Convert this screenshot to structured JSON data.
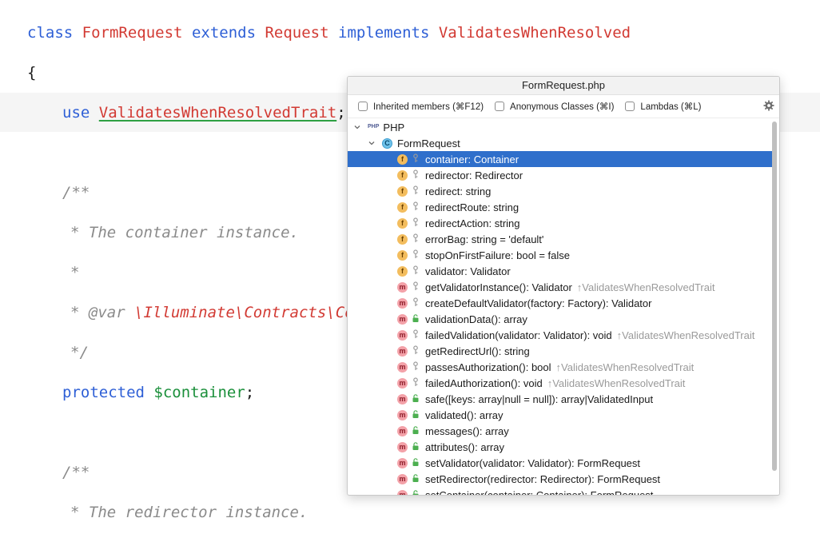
{
  "editor": {
    "line1": {
      "kw_class": "class",
      "name": "FormRequest",
      "kw_extends": "extends",
      "parent": "Request",
      "kw_implements": "implements",
      "iface": "ValidatesWhenResolved"
    },
    "brace": "{",
    "use_line": {
      "kw": "use",
      "trait": "ValidatesWhenResolvedTrait",
      "semi": ";"
    },
    "doc1_open": "/**",
    "doc1_text": "* The container instance.",
    "doc1_star": "*",
    "doc1_var_tag": "* @var",
    "doc1_var_type": "\\Illuminate\\Contracts\\Con",
    "doc1_close": "*/",
    "prop": {
      "kw": "protected",
      "var": "$container",
      "semi": ";"
    },
    "doc2_open": "/**",
    "doc2_text": "* The redirector instance."
  },
  "popup": {
    "title": "FormRequest.php",
    "filters": [
      {
        "label": "Inherited members (⌘F12)",
        "checked": false
      },
      {
        "label": "Anonymous Classes (⌘I)",
        "checked": false
      },
      {
        "label": "Lambdas (⌘L)",
        "checked": false
      }
    ],
    "settings_icon": "gear-icon",
    "root": {
      "label": "PHP",
      "icon": "php-icon"
    },
    "class_node": {
      "label": "FormRequest",
      "icon": "class-icon",
      "badge": "C"
    },
    "members": [
      {
        "kind": "f",
        "visibility": "protected",
        "text": "container: Container",
        "inherited": "",
        "selected": true
      },
      {
        "kind": "f",
        "visibility": "protected",
        "text": "redirector: Redirector",
        "inherited": ""
      },
      {
        "kind": "f",
        "visibility": "protected",
        "text": "redirect: string",
        "inherited": ""
      },
      {
        "kind": "f",
        "visibility": "protected",
        "text": "redirectRoute: string",
        "inherited": ""
      },
      {
        "kind": "f",
        "visibility": "protected",
        "text": "redirectAction: string",
        "inherited": ""
      },
      {
        "kind": "f",
        "visibility": "protected",
        "text": "errorBag: string = 'default'",
        "inherited": ""
      },
      {
        "kind": "f",
        "visibility": "protected",
        "text": "stopOnFirstFailure: bool = false",
        "inherited": ""
      },
      {
        "kind": "f",
        "visibility": "protected",
        "text": "validator: Validator",
        "inherited": ""
      },
      {
        "kind": "m",
        "visibility": "protected",
        "text": "getValidatorInstance(): Validator",
        "inherited": "↑ValidatesWhenResolvedTrait"
      },
      {
        "kind": "m",
        "visibility": "protected",
        "text": "createDefaultValidator(factory: Factory): Validator",
        "inherited": ""
      },
      {
        "kind": "m",
        "visibility": "public",
        "text": "validationData(): array",
        "inherited": ""
      },
      {
        "kind": "m",
        "visibility": "protected",
        "text": "failedValidation(validator: Validator): void",
        "inherited": "↑ValidatesWhenResolvedTrait"
      },
      {
        "kind": "m",
        "visibility": "protected",
        "text": "getRedirectUrl(): string",
        "inherited": ""
      },
      {
        "kind": "m",
        "visibility": "protected",
        "text": "passesAuthorization(): bool",
        "inherited": "↑ValidatesWhenResolvedTrait"
      },
      {
        "kind": "m",
        "visibility": "protected",
        "text": "failedAuthorization(): void",
        "inherited": "↑ValidatesWhenResolvedTrait"
      },
      {
        "kind": "m",
        "visibility": "public",
        "text": "safe([keys: array|null = null]): array|ValidatedInput",
        "inherited": ""
      },
      {
        "kind": "m",
        "visibility": "public",
        "text": "validated(): array",
        "inherited": ""
      },
      {
        "kind": "m",
        "visibility": "public",
        "text": "messages(): array",
        "inherited": ""
      },
      {
        "kind": "m",
        "visibility": "public",
        "text": "attributes(): array",
        "inherited": ""
      },
      {
        "kind": "m",
        "visibility": "public",
        "text": "setValidator(validator: Validator): FormRequest",
        "inherited": ""
      },
      {
        "kind": "m",
        "visibility": "public",
        "text": "setRedirector(redirector: Redirector): FormRequest",
        "inherited": ""
      },
      {
        "kind": "m",
        "visibility": "public",
        "text": "setContainer(container: Container): FormRequest",
        "inherited": ""
      }
    ],
    "colors": {
      "selection": "#2f6fcb",
      "field_badge": "#f3bd5e",
      "method_badge": "#f3a1a8",
      "public_lock": "#4caf50",
      "protected_key": "#9a9a9a"
    }
  }
}
